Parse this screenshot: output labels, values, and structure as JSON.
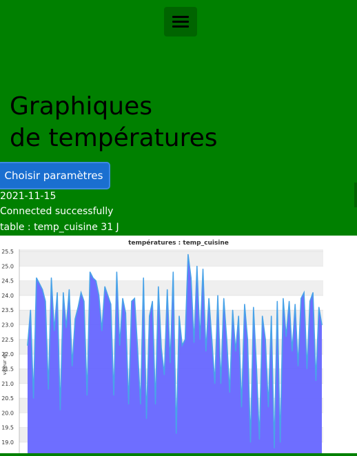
{
  "menu": {
    "icon": "hamburger-menu-icon"
  },
  "title_lines": [
    "Graphiques",
    "de températures"
  ],
  "button": {
    "label": "Choisir paramètres"
  },
  "info": {
    "date": "2021-11-15",
    "status": "Connected successfully",
    "table": "table : temp_cuisine 31 J"
  },
  "colors": {
    "background": "#008000",
    "button": "#1a6fd0",
    "fill": "#6666ff",
    "line": "#4aa3e8"
  },
  "chart_data": {
    "type": "area",
    "title": "températures : temp_cuisine",
    "ylabel": "valeur en",
    "ylim": [
      18.7,
      25.6
    ],
    "ticks": [
      "19.0",
      "19.5",
      "20.0",
      "20.5",
      "21.0",
      "21.5",
      "22.0",
      "22.5",
      "23.0",
      "23.5",
      "24.0",
      "24.5",
      "25.0",
      "25.5"
    ],
    "values": [
      22.3,
      23.5,
      20.5,
      24.6,
      24.4,
      24.2,
      23.8,
      20.8,
      24.6,
      22.8,
      24.1,
      20.1,
      24.1,
      22.9,
      24.2,
      21.6,
      23.2,
      23.6,
      24.1,
      23.8,
      20.6,
      24.8,
      24.6,
      24.5,
      24.0,
      22.8,
      24.3,
      24.0,
      23.7,
      20.6,
      24.8,
      22.3,
      23.9,
      23.4,
      20.3,
      23.8,
      23.9,
      22.2,
      20.3,
      24.6,
      19.8,
      23.3,
      23.8,
      20.3,
      24.3,
      22.2,
      21.3,
      24.2,
      21.7,
      24.8,
      19.3,
      23.3,
      22.3,
      22.5,
      25.4,
      24.6,
      22.4,
      25.0,
      22.5,
      24.9,
      22.1,
      23.9,
      22.5,
      21.0,
      24.0,
      21.0,
      23.9,
      22.5,
      20.7,
      23.5,
      22.1,
      23.3,
      20.2,
      23.7,
      22.5,
      19.0,
      23.6,
      21.6,
      19.1,
      23.3,
      22.5,
      20.2,
      23.3,
      18.8,
      23.8,
      19.0,
      23.9,
      22.6,
      23.8,
      22.1,
      23.7,
      21.6,
      23.9,
      24.1,
      21.5,
      23.8,
      24.1,
      21.1,
      23.6,
      23.0
    ]
  }
}
